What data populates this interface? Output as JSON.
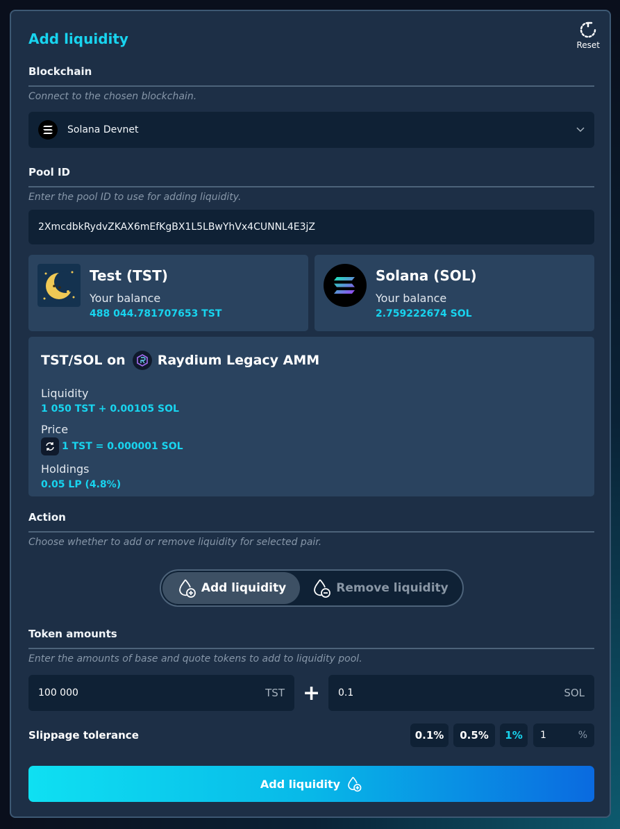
{
  "header": {
    "title": "Add liquidity",
    "reset_label": "Reset"
  },
  "blockchain": {
    "label": "Blockchain",
    "hint": "Connect to the chosen blockchain.",
    "selected": "Solana Devnet"
  },
  "pool": {
    "label": "Pool ID",
    "hint": "Enter the pool ID to use for adding liquidity.",
    "value": "2XmcdbkRydvZKAX6mEfKgBX1L5LBwYhVx4CUNNL4E3jZ"
  },
  "tokens": [
    {
      "name": "Test (TST)",
      "balance_label": "Your balance",
      "balance": "488 044.781707653 TST"
    },
    {
      "name": "Solana (SOL)",
      "balance_label": "Your balance",
      "balance": "2.759222674 SOL"
    }
  ],
  "pool_info": {
    "pair": "TST/SOL on",
    "dex": "Raydium Legacy AMM",
    "liquidity_label": "Liquidity",
    "liquidity": "1 050 TST + 0.00105 SOL",
    "price_label": "Price",
    "price": "1 TST = 0.000001 SOL",
    "holdings_label": "Holdings",
    "holdings": "0.05 LP (4.8%)"
  },
  "action": {
    "label": "Action",
    "hint": "Choose whether to add or remove liquidity for selected pair.",
    "add": "Add liquidity",
    "remove": "Remove liquidity",
    "selected": "add"
  },
  "amounts": {
    "label": "Token amounts",
    "hint": "Enter the amounts of base and quote tokens to add to liquidity pool.",
    "base_value": "100 000",
    "base_unit": "TST",
    "quote_value": "0.1",
    "quote_unit": "SOL",
    "plus": "+"
  },
  "slippage": {
    "label": "Slippage tolerance",
    "options": [
      "0.1%",
      "0.5%",
      "1%"
    ],
    "selected": "1%",
    "custom_value": "1",
    "custom_unit": "%"
  },
  "submit": {
    "label": "Add liquidity"
  },
  "colors": {
    "accent": "#18d4ef",
    "panel": "#1d2f46",
    "field": "#0f2135",
    "card": "#2a435f"
  }
}
